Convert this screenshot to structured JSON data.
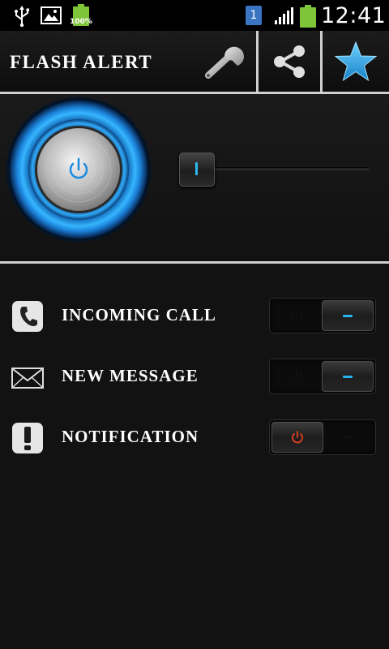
{
  "status_bar": {
    "battery_percent": "100%",
    "sim_slot": "1",
    "time": "12:41"
  },
  "action_bar": {
    "title": "FLASH ALERT",
    "icons": [
      "wrench-icon",
      "share-icon",
      "star-icon"
    ]
  },
  "flashlight": {
    "power_on": true,
    "brightness_fraction": 0.06
  },
  "alerts": [
    {
      "label": "INCOMING CALL",
      "icon": "phone-icon",
      "state": "on"
    },
    {
      "label": "NEW MESSAGE",
      "icon": "envelope-icon",
      "state": "on"
    },
    {
      "label": "NOTIFICATION",
      "icon": "exclamation-icon",
      "state": "off"
    }
  ],
  "colors": {
    "accent_blue": "#1ea6e6",
    "off_red": "#e8401c",
    "divider": "#cfcfcf"
  }
}
